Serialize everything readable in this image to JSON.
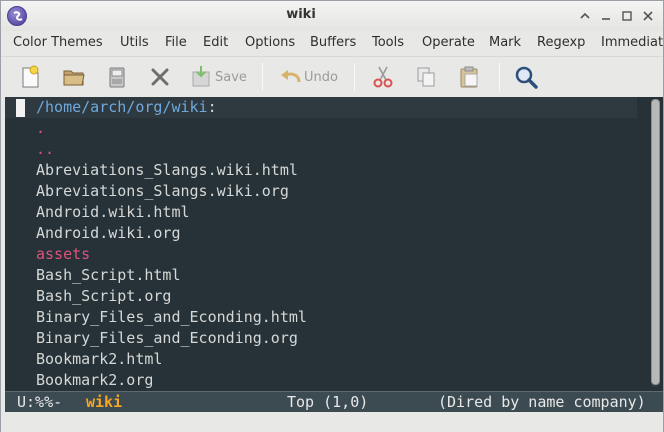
{
  "window": {
    "title": "wiki"
  },
  "menubar": {
    "items": [
      "Color Themes",
      "Utils",
      "File",
      "Edit",
      "Options",
      "Buffers",
      "Tools",
      "Operate",
      "Mark",
      "Regexp",
      "Immediate"
    ]
  },
  "toolbar": {
    "save_label": "Save",
    "undo_label": "Undo"
  },
  "dired": {
    "path": "/home/arch/org/wiki",
    "colon": ":",
    "entries": [
      ".",
      "..",
      "Abreviations_Slangs.wiki.html",
      "Abreviations_Slangs.wiki.org",
      "Android.wiki.html",
      "Android.wiki.org",
      "assets",
      "Bash_Script.html",
      "Bash_Script.org",
      "Binary_Files_and_Econding.html",
      "Binary_Files_and_Econding.org",
      "Bookmark2.html",
      "Bookmark2.org"
    ]
  },
  "modeline": {
    "status": "U:%%-",
    "buffer": "wiki",
    "position": "Top (1,0)",
    "mode": "(Dired by name company)"
  },
  "colors": {
    "editor_bg": "#263238",
    "directory": "#e0527a",
    "path": "#6fa8dc",
    "buffer_name": "#f5a623"
  }
}
